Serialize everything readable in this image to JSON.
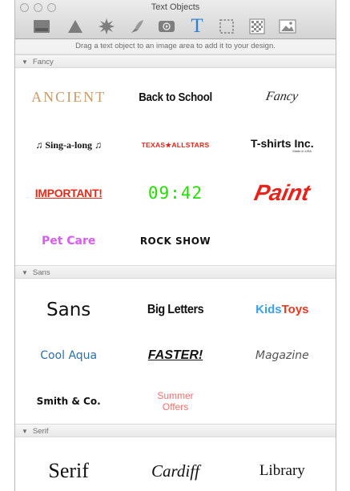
{
  "window": {
    "title": "Text Objects"
  },
  "toolbar": {
    "buttons": [
      {
        "icon": "rectangle-shape-icon"
      },
      {
        "icon": "triangle-shape-icon"
      },
      {
        "icon": "starburst-shape-icon"
      },
      {
        "icon": "clip-art-icon"
      },
      {
        "icon": "button-shape-icon"
      },
      {
        "icon": "text-object-icon"
      },
      {
        "icon": "image-area-icon"
      },
      {
        "icon": "background-pattern-icon"
      },
      {
        "icon": "photo-icon"
      }
    ],
    "selected_index": 5,
    "text_tool_glyph": "T",
    "accent_color": "#2f7fd0"
  },
  "instruction": "Drag a text object to an image area to add it to your design.",
  "sections": [
    {
      "label": "Fancy",
      "items": [
        {
          "text": "ANCIENT",
          "color": "#c99a6b"
        },
        {
          "text": "Back to School",
          "color": "#111111"
        },
        {
          "text": "Fancy",
          "color": "#222222"
        },
        {
          "text": "♫ Sing-a-long ♫",
          "color": "#111111"
        },
        {
          "text": "TEXAS★ALLSTARS",
          "color": "#e0251b"
        },
        {
          "text": "T-shirts Inc.",
          "subtext": "Made in USA",
          "color": "#111111"
        },
        {
          "text": "IMPORTANT!",
          "color": "#e52a1a"
        },
        {
          "text": "09:42",
          "color": "#22e000"
        },
        {
          "text": "Paint",
          "color": "#e8221a"
        },
        {
          "text": "Pet Care",
          "color": "#d85cf2"
        },
        {
          "text": "ROCK SHOW",
          "color": "#111111"
        }
      ]
    },
    {
      "label": "Sans",
      "items": [
        {
          "text": "Sans",
          "color": "#111111"
        },
        {
          "text": "Big Letters",
          "color": "#111111"
        },
        {
          "text": "Kids",
          "text2": "Toys",
          "color": "#3aa0e8",
          "color2": "#e8371c"
        },
        {
          "text": "Cool Aqua",
          "color": "#2d6fa7"
        },
        {
          "text": "FASTER!",
          "color": "#111111"
        },
        {
          "text": "Magazine",
          "color": "#555555"
        },
        {
          "text": "Smith & Co.",
          "color": "#111111"
        },
        {
          "text": "Summer Offers",
          "color": "#f47070"
        }
      ]
    },
    {
      "label": "Serif",
      "items": [
        {
          "text": "Serif",
          "color": "#111111"
        },
        {
          "text": "Cardiff",
          "color": "#111111"
        },
        {
          "text": "Library",
          "color": "#111111"
        }
      ]
    }
  ]
}
